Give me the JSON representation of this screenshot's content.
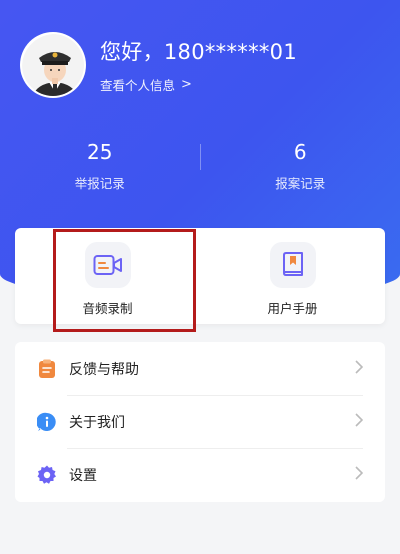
{
  "profile": {
    "greeting": "您好，180******01",
    "info_link": "查看个人信息",
    "info_chevron": ">"
  },
  "stats": [
    {
      "value": "25",
      "label": "举报记录"
    },
    {
      "value": "6",
      "label": "报案记录"
    }
  ],
  "tools": [
    {
      "label": "音频录制",
      "icon": "video-record-icon"
    },
    {
      "label": "用户手册",
      "icon": "book-icon"
    }
  ],
  "menu": [
    {
      "label": "反馈与帮助",
      "icon": "clipboard-icon"
    },
    {
      "label": "关于我们",
      "icon": "info-icon"
    },
    {
      "label": "设置",
      "icon": "gear-icon"
    }
  ],
  "colors": {
    "header": "#4357f1",
    "highlight": "#b41b1b",
    "accent_orange": "#f0883e",
    "accent_blue": "#3a8df5",
    "accent_purple": "#6c63f5"
  }
}
